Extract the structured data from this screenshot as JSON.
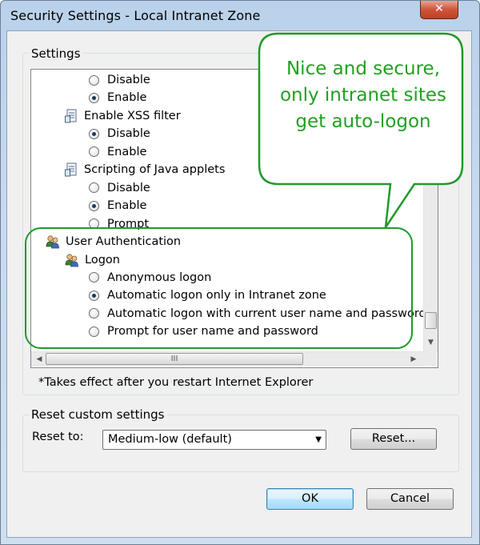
{
  "window": {
    "title": "Security Settings - Local Intranet Zone",
    "close_glyph": "✕"
  },
  "settings_group": {
    "label": "Settings",
    "tree": [
      {
        "kind": "radio",
        "label": "Disable",
        "checked": false
      },
      {
        "kind": "radio",
        "label": "Enable",
        "checked": true
      },
      {
        "kind": "setting",
        "label": "Enable XSS filter",
        "icon": "settings-document-icon"
      },
      {
        "kind": "radio",
        "label": "Disable",
        "checked": true
      },
      {
        "kind": "radio",
        "label": "Enable",
        "checked": false
      },
      {
        "kind": "setting",
        "label": "Scripting of Java applets",
        "icon": "settings-document-icon"
      },
      {
        "kind": "radio",
        "label": "Disable",
        "checked": false
      },
      {
        "kind": "radio",
        "label": "Enable",
        "checked": true
      },
      {
        "kind": "radio",
        "label": "Prompt",
        "checked": false
      },
      {
        "kind": "category",
        "label": "User Authentication",
        "icon": "users-icon"
      },
      {
        "kind": "setting",
        "label": "Logon",
        "icon": "users-icon"
      },
      {
        "kind": "radio",
        "label": "Anonymous logon",
        "checked": false
      },
      {
        "kind": "radio",
        "label": "Automatic logon only in Intranet zone",
        "checked": true
      },
      {
        "kind": "radio",
        "label": "Automatic logon with current user name and password",
        "checked": false
      },
      {
        "kind": "radio",
        "label": "Prompt for user name and password",
        "checked": false
      }
    ],
    "note": "*Takes effect after you restart Internet Explorer",
    "hscroll_grip": "III"
  },
  "reset_group": {
    "label": "Reset custom settings",
    "reset_to_label": "Reset to:",
    "dropdown_value": "Medium-low (default)",
    "reset_button": "Reset..."
  },
  "buttons": {
    "ok": "OK",
    "cancel": "Cancel"
  },
  "annotation": {
    "callout_text": "Nice and secure, only intranet sites get auto-logon",
    "color": "#22a022"
  }
}
